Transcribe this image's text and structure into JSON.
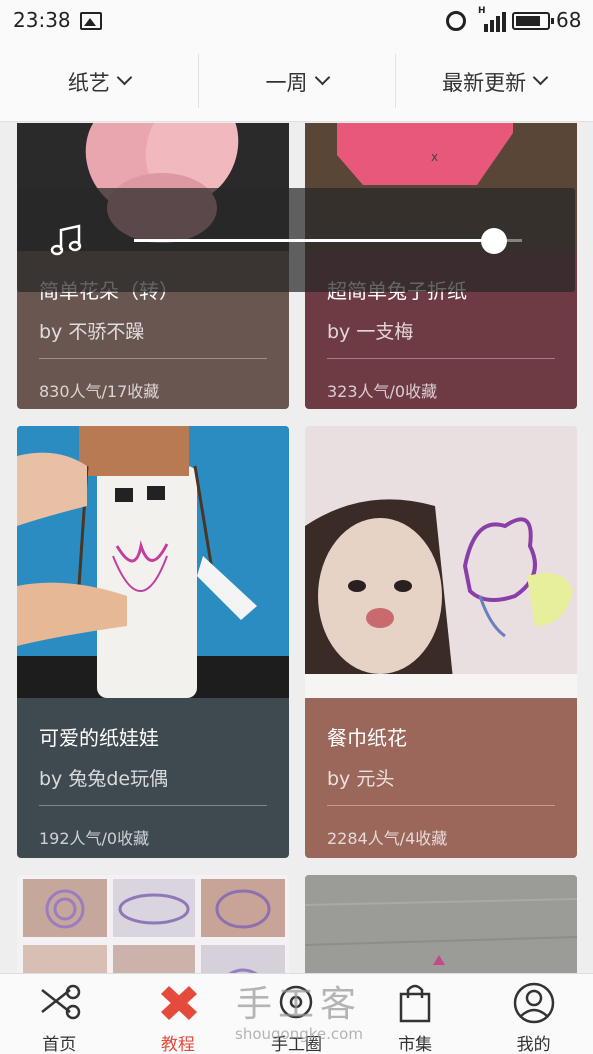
{
  "status_bar": {
    "time": "23:38",
    "signal_label": "H",
    "battery_level": "68"
  },
  "filters": [
    {
      "label": "纸艺"
    },
    {
      "label": "一周"
    },
    {
      "label": "最新更新"
    }
  ],
  "cards": [
    {
      "title": "简单花朵（转）",
      "author": "by 不骄不躁",
      "stats": "830人气/17收藏",
      "bg_color": "#6a5650"
    },
    {
      "title": "超简单兔子折纸",
      "author": "by 一支梅",
      "stats": "323人气/0收藏",
      "bg_color": "#6e3a43"
    },
    {
      "title": "可爱的纸娃娃",
      "author": "by 兔兔de玩偶",
      "stats": "192人气/0收藏",
      "bg_color": "#3e4950"
    },
    {
      "title": "餐巾纸花",
      "author": "by 元头",
      "stats": "2284人气/4收藏",
      "bg_color": "#9b675b"
    }
  ],
  "music_player": {
    "progress": 0.95
  },
  "tabs": [
    {
      "label": "首页",
      "icon": "scissors-icon",
      "active": false
    },
    {
      "label": "教程",
      "icon": "tutorial-icon",
      "active": true
    },
    {
      "label": "手工圈",
      "icon": "circle-icon",
      "active": false
    },
    {
      "label": "市集",
      "icon": "shopping-bag-icon",
      "active": false
    },
    {
      "label": "我的",
      "icon": "profile-icon",
      "active": false
    }
  ],
  "watermark": {
    "name": "手工客",
    "url": "shougongke.com"
  },
  "colors": {
    "accent": "#e54b3d"
  }
}
